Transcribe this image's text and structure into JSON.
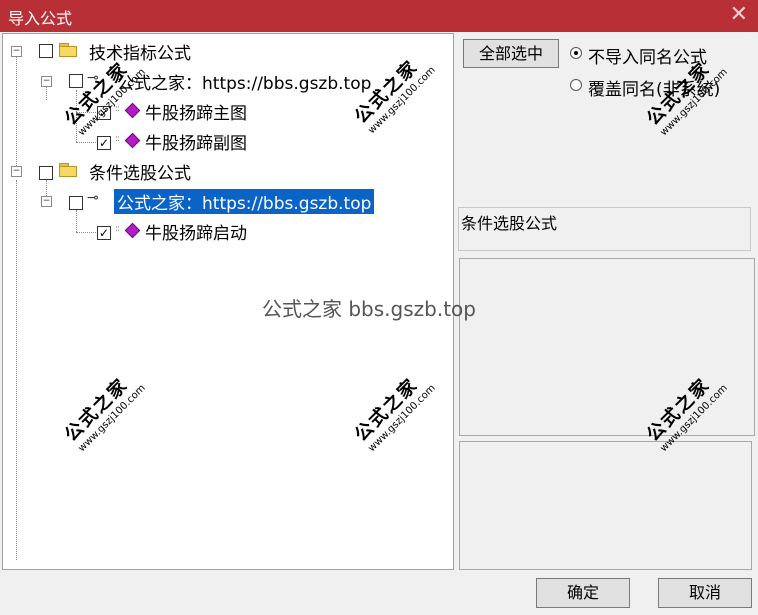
{
  "window": {
    "title": "导入公式",
    "close_glyph": "✕"
  },
  "tree": {
    "group1": {
      "label": "技术指标公式",
      "child": {
        "label": "公式之家：https://bbs.gszb.top",
        "items": [
          "牛股扬蹄主图",
          "牛股扬蹄副图"
        ]
      }
    },
    "group2": {
      "label": "条件选股公式",
      "child": {
        "label": "公式之家：https://bbs.gszb.top",
        "items": [
          "牛股扬蹄启动"
        ]
      }
    },
    "check_glyph": "✓",
    "expand_glyph": "−",
    "key_glyph": "⊸"
  },
  "right_panel": {
    "select_all_label": "全部选中",
    "radio_no_import": "不导入同名公式",
    "radio_overwrite": "覆盖同名(非系统)",
    "info_text": "条件选股公式"
  },
  "footer": {
    "ok_label": "确定",
    "cancel_label": "取消"
  },
  "overlay": {
    "center_text": "公式之家 bbs.gszb.top",
    "watermark_cn": "公式之家",
    "watermark_url": "www.gszj100.com"
  }
}
